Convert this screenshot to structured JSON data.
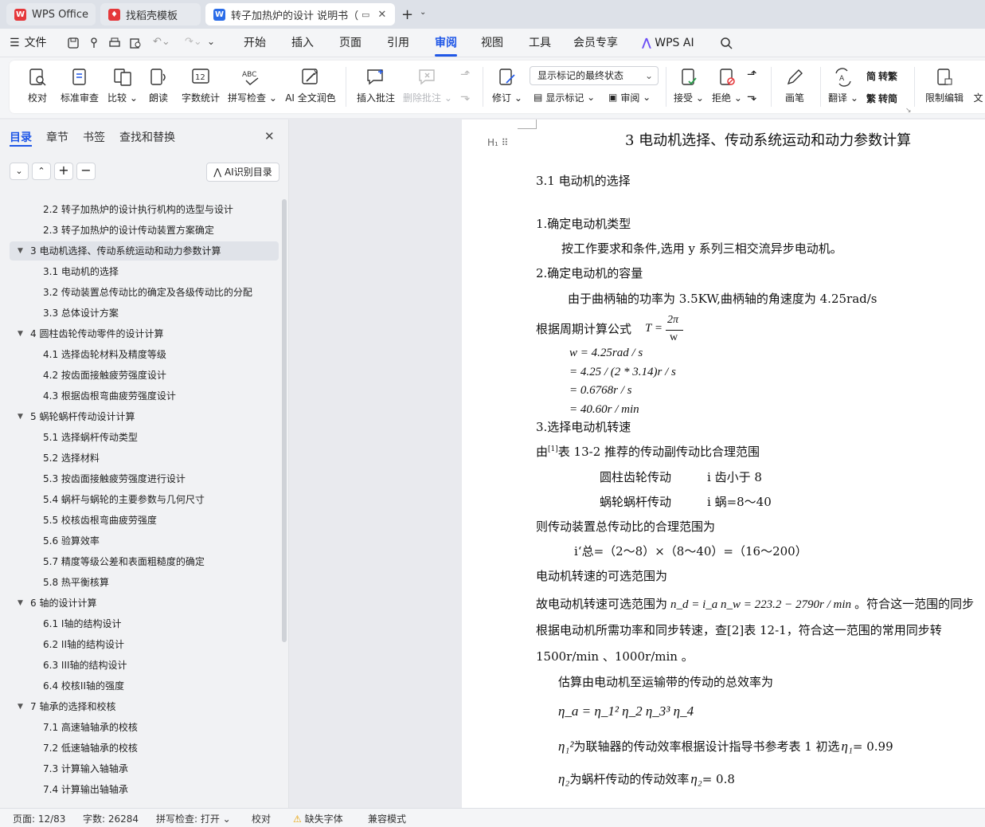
{
  "tabs": [
    {
      "label": "WPS Office"
    },
    {
      "label": "找稻壳模板"
    },
    {
      "label": "转子加热炉的设计 说明书（论"
    }
  ],
  "menu": {
    "file": "文件",
    "items": [
      "开始",
      "插入",
      "页面",
      "引用",
      "审阅",
      "视图",
      "工具",
      "会员专享"
    ],
    "active": "审阅",
    "ai": "WPS AI"
  },
  "ribbon": {
    "proofread": "校对",
    "standard_review": "标准审查",
    "compare": "比较",
    "read_aloud": "朗读",
    "word_count": "字数统计",
    "spell_check": "拼写检查",
    "ai_polish": "AI 全文润色",
    "insert_comment": "插入批注",
    "delete_comment": "删除批注",
    "track_changes": "修订",
    "display_select": "显示标记的最终状态",
    "show_markup": "显示标记",
    "review_pane": "审阅",
    "accept": "接受",
    "reject": "拒绝",
    "pen": "画笔",
    "translate": "翻译",
    "to_traditional": "转繁",
    "to_simplified": "转简",
    "restrict_edit": "限制编辑",
    "doc_partial": "文"
  },
  "panel": {
    "tabs": [
      "目录",
      "章节",
      "书签",
      "查找和替换"
    ],
    "ai_toc": "AI识别目录",
    "toc": [
      {
        "text": "2.2  转子加热炉的设计执行机构的选型与设计",
        "level": 2
      },
      {
        "text": "2.3  转子加热炉的设计传动装置方案确定",
        "level": 2
      },
      {
        "text": "3    电动机选择、传动系统运动和动力参数计算",
        "level": 1,
        "selected": true
      },
      {
        "text": "3.1 电动机的选择",
        "level": 2
      },
      {
        "text": "3.2  传动装置总传动比的确定及各级传动比的分配",
        "level": 2
      },
      {
        "text": "3.3  总体设计方案",
        "level": 2
      },
      {
        "text": "4    圆柱齿轮传动零件的设计计算",
        "level": 1
      },
      {
        "text": "4.1  选择齿轮材料及精度等级",
        "level": 2
      },
      {
        "text": "4.2 按齿面接触疲劳强度设计",
        "level": 2
      },
      {
        "text": "4.3  根据齿根弯曲疲劳强度设计",
        "level": 2
      },
      {
        "text": "5    蜗轮蜗杆传动设计计算",
        "level": 1
      },
      {
        "text": "5.1  选择蜗杆传动类型",
        "level": 2
      },
      {
        "text": "5.2  选择材料",
        "level": 2
      },
      {
        "text": "5.3  按齿面接触疲劳强度进行设计",
        "level": 2
      },
      {
        "text": "5.4  蜗杆与蜗轮的主要参数与几何尺寸",
        "level": 2
      },
      {
        "text": "5.5  校核齿根弯曲疲劳强度",
        "level": 2
      },
      {
        "text": "5.6  验算效率",
        "level": 2
      },
      {
        "text": "5.7  精度等级公差和表面粗糙度的确定",
        "level": 2
      },
      {
        "text": "5.8  热平衡核算",
        "level": 2
      },
      {
        "text": "6    轴的设计计算",
        "level": 1
      },
      {
        "text": "6.1 I轴的结构设计",
        "level": 2
      },
      {
        "text": "6.2 II轴的结构设计",
        "level": 2
      },
      {
        "text": "6.3 III轴的结构设计",
        "level": 2
      },
      {
        "text": "6.4  校核II轴的强度",
        "level": 2
      },
      {
        "text": "7    轴承的选择和校核",
        "level": 1
      },
      {
        "text": "7.1  高速轴轴承的校核",
        "level": 2
      },
      {
        "text": "7.2  低速轴轴承的校核",
        "level": 2
      },
      {
        "text": "7.3  计算输入轴轴承",
        "level": 2
      },
      {
        "text": "7.4  计算输出轴轴承",
        "level": 2
      }
    ]
  },
  "doc": {
    "heading_marker": "H₁",
    "heading": "3    电动机选择、传动系统运动和动力参数计算",
    "s31": "3.1 电动机的选择",
    "p1": "1.确定电动机类型",
    "p2": "按工作要求和条件,选用 y 系列三相交流异步电动机。",
    "p3": "2.确定电动机的容量",
    "p4": "由于曲柄轴的功率为 3.5KW,曲柄轴的角速度为 4.25rad/s",
    "p5": "根据周期计算公式",
    "formula_T": "T =",
    "formula_num": "2π",
    "formula_den": "w",
    "eq1": "w = 4.25rad / s",
    "eq2": "= 4.25 / (2 * 3.14)r / s",
    "eq3": "= 0.6768r / s",
    "eq4": "= 40.60r / min",
    "p6": "3.选择电动机转速",
    "p7a": "由",
    "p7ref": "[1]",
    "p7b": "表 13-2 推荐的传动副传动比合理范围",
    "p8a": "圆柱齿轮传动",
    "p8b": "i 齿小于 8",
    "p9a": "蜗轮蜗杆传动",
    "p9b": "i 蜗=8～40",
    "p10": "则传动装置总传动比的合理范围为",
    "p11": "i‘总=（2～8）×（8～40）=（16～200）",
    "p12": "电动机转速的可选范围为",
    "p13a": "故电动机转速可选范围为",
    "p13f": "n_d = i_a n_w = 223.2 − 2790r / min",
    "p13b": "。符合这一范围的同步",
    "p14": "根据电动机所需功率和同步转速，查[2]表 12-1，符合这一范围的常用同步转",
    "p15": "1500r/min 、1000r/min  。",
    "p16": "估算由电动机至运输带的传动的总效率为",
    "p17": "η_a = η_1² η_2 η_3³ η_4",
    "p18a": "为联轴器的传动效率根据设计指导书参考表 1 初选",
    "p18v": "= 0.99",
    "p19a": "为蜗杆传动的传动效率",
    "p19v": "= 0.8"
  },
  "status": {
    "page": "页面: 12/83",
    "words": "字数: 26284",
    "spell": "拼写检查: 打开",
    "proof": "校对",
    "missing_font": "缺失字体",
    "compat": "兼容模式"
  },
  "colors": {
    "accent": "#1f57e7",
    "wps_red": "#e5383b",
    "tab_active": "#ffffff"
  }
}
